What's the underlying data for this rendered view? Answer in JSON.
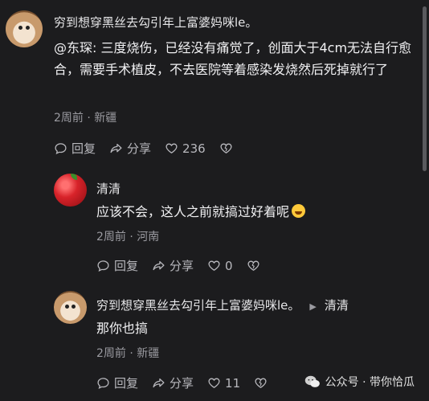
{
  "comments": [
    {
      "user": "穷到想穿黑丝去勾引年上富婆妈咪le。",
      "text": "@东琛: 三度烧伤，已经没有痛觉了，创面大于4cm无法自行愈合，需要手术植皮，不去医院等着感染发烧然后死掉就行了",
      "meta": "2周前 · 新疆",
      "reply_label": "回复",
      "share_label": "分享",
      "like_count": "236"
    },
    {
      "user": "清清",
      "text": "应该不会，这人之前就搞过好着呢",
      "meta": "2周前 · 河南",
      "reply_label": "回复",
      "share_label": "分享",
      "like_count": "0"
    },
    {
      "user": "穷到想穿黑丝去勾引年上富婆妈咪le。",
      "reply_to": "清清",
      "text": "那你也搞",
      "meta": "2周前 · 新疆",
      "reply_label": "回复",
      "share_label": "分享",
      "like_count": "11"
    }
  ],
  "watermark": "公众号 · 带你恰瓜"
}
